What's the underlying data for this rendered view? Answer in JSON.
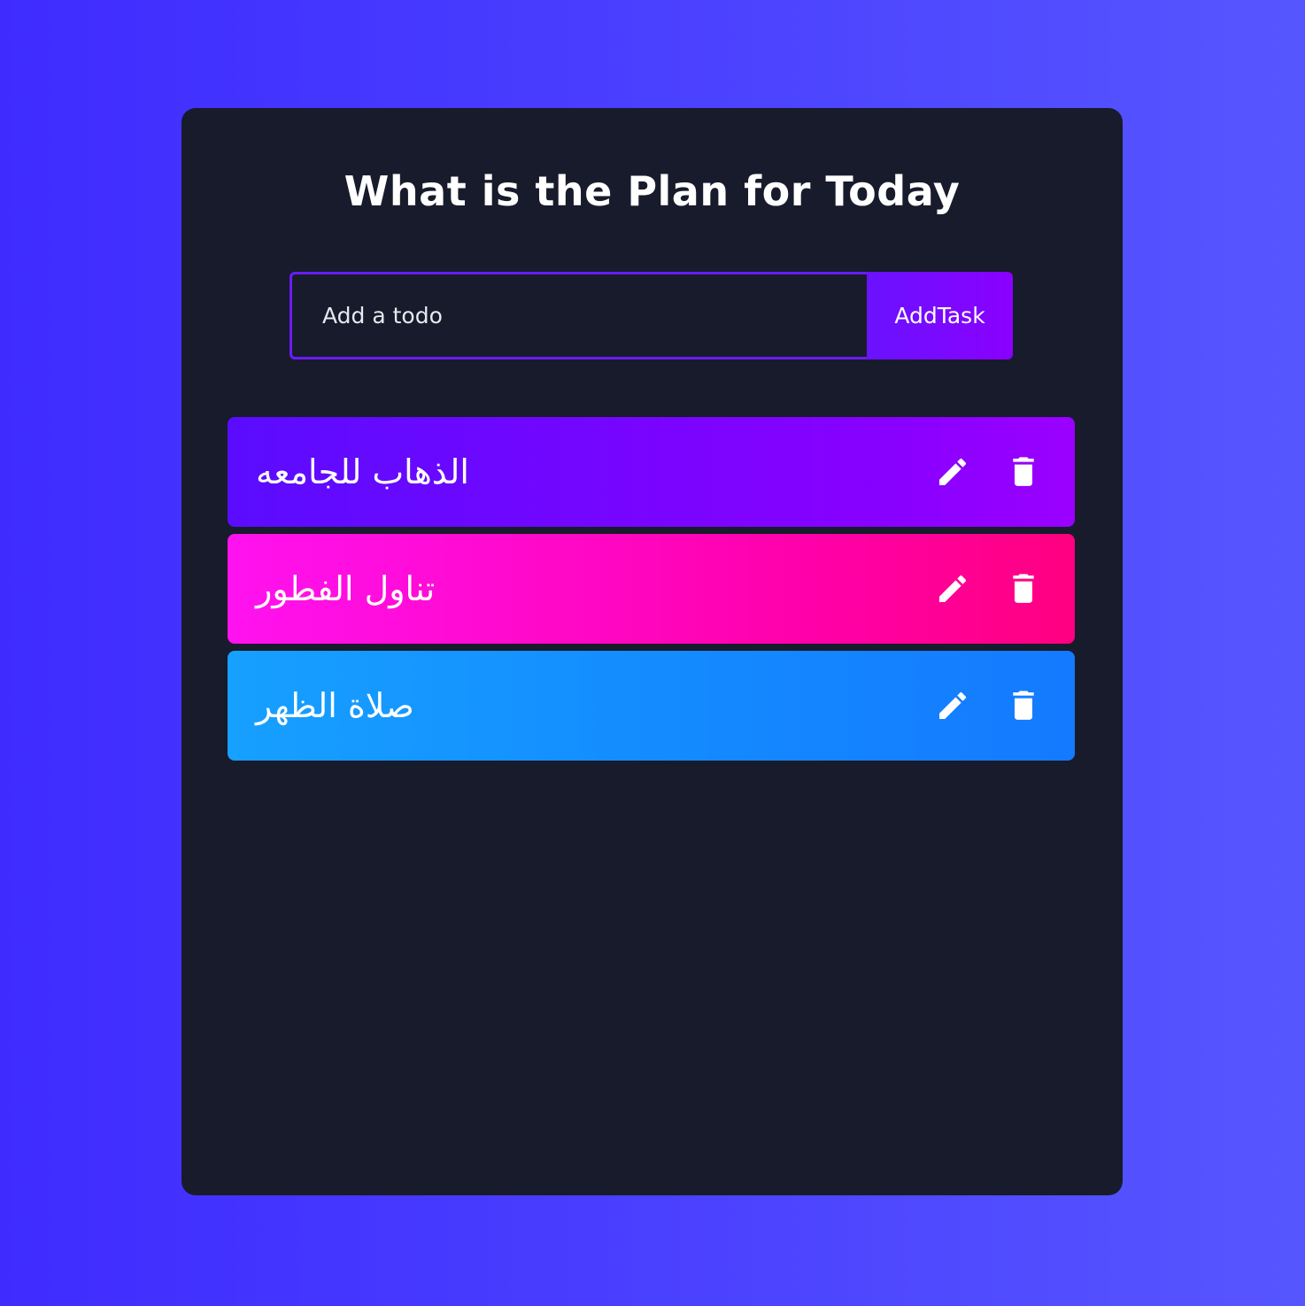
{
  "app": {
    "title": "What is the Plan for Today"
  },
  "form": {
    "input_placeholder": "Add a todo",
    "input_value": "",
    "add_button_label": "AddTask"
  },
  "todos": [
    {
      "text": "الذهاب للجامعه",
      "color_from": "#5a0cff",
      "color_to": "#9a00ff",
      "edit_icon": "edit-icon",
      "delete_icon": "delete-icon"
    },
    {
      "text": "تناول الفطور",
      "color_from": "#ff12f0",
      "color_to": "#ff0080",
      "edit_icon": "edit-icon",
      "delete_icon": "delete-icon"
    },
    {
      "text": "صلاة الظهر",
      "color_from": "#16a0ff",
      "color_to": "#147aff",
      "edit_icon": "edit-icon",
      "delete_icon": "delete-icon"
    }
  ],
  "colors": {
    "background_from": "#3f2bff",
    "background_to": "#5656ff",
    "card": "#181b2b",
    "input_border": "#6b1cff",
    "button_from": "#6a12ff",
    "button_to": "#8a00ff"
  }
}
